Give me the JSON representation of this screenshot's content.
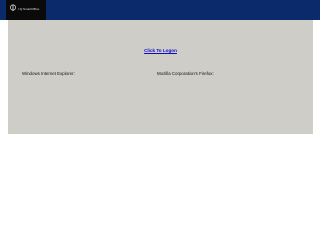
{
  "header": {
    "logo_text": "I.Q.SmartOffice",
    "logo_icon": "iq-logo-icon",
    "background_color": "#0b2a6b"
  },
  "main": {
    "logon_link": "Click To Logon",
    "ie_label": "Windows Internet Explorer:",
    "firefox_label": "Mozilla Corporation's Firefox:",
    "panel_color": "#cfcdc7",
    "link_color": "#0b0bd0"
  }
}
